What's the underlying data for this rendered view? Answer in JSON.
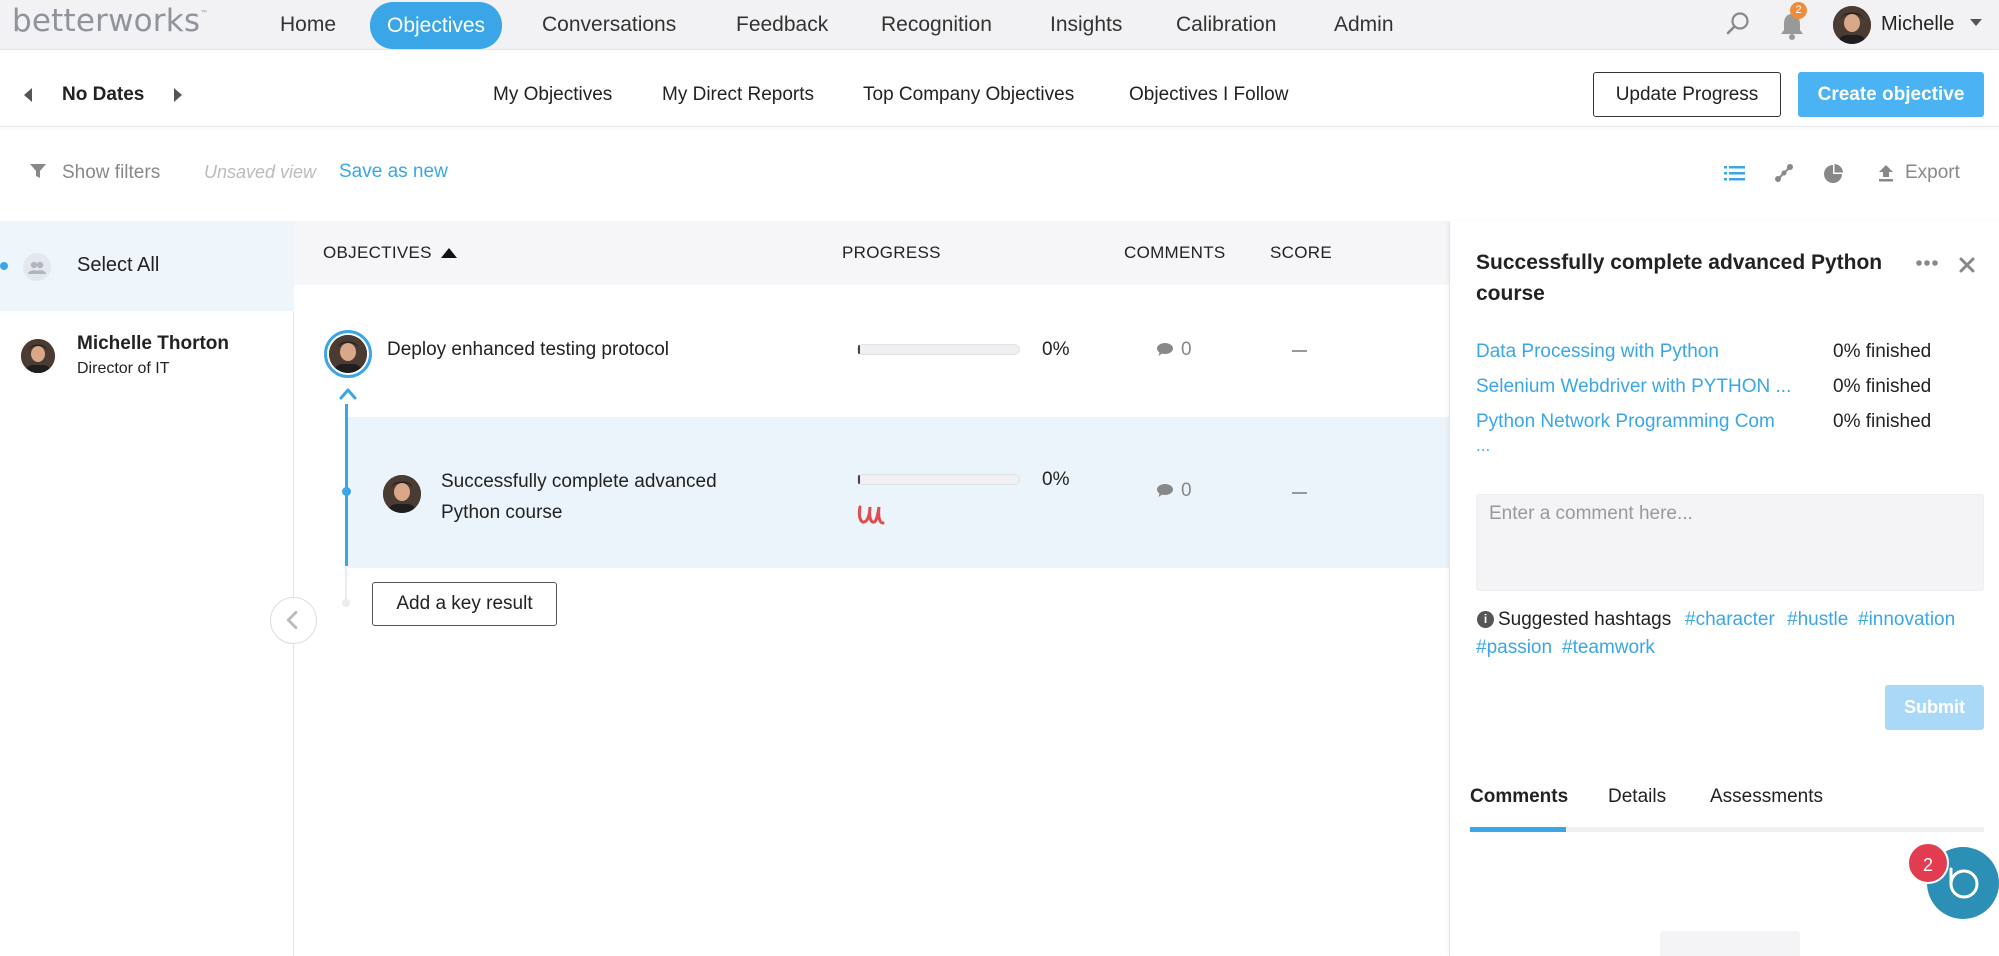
{
  "app": {
    "logo_text": "betterworks"
  },
  "topnav": {
    "items": [
      {
        "label": "Home"
      },
      {
        "label": "Objectives",
        "active": true
      },
      {
        "label": "Conversations"
      },
      {
        "label": "Feedback"
      },
      {
        "label": "Recognition"
      },
      {
        "label": "Insights"
      },
      {
        "label": "Calibration"
      },
      {
        "label": "Admin"
      }
    ],
    "notification_count": "2",
    "username": "Michelle",
    "icons": [
      "search-icon",
      "bell-icon",
      "chevron-down-icon"
    ]
  },
  "subnav": {
    "date_range": "No Dates",
    "tabs": [
      {
        "label": "My Objectives"
      },
      {
        "label": "My Direct Reports"
      },
      {
        "label": "Top Company Objectives"
      },
      {
        "label": "Objectives I Follow"
      }
    ],
    "update_progress_label": "Update Progress",
    "create_objective_label": "Create objective"
  },
  "filters": {
    "show_filters_label": "Show filters",
    "unsaved_view_label": "Unsaved view",
    "save_as_new_label": "Save as new",
    "export_label": "Export",
    "view_icons": [
      "list-view-icon",
      "tree-view-icon",
      "pie-chart-icon",
      "export-icon"
    ]
  },
  "left_panel": {
    "select_all_label": "Select All",
    "user": {
      "name": "Michelle Thorton",
      "title": "Director of IT"
    }
  },
  "table": {
    "headers": {
      "objectives": "OBJECTIVES",
      "progress": "PROGRESS",
      "comments": "COMMENTS",
      "score": "SCORE"
    },
    "objective": {
      "title": "Deploy enhanced testing protocol",
      "progress_pct": "0%",
      "progress_value": 0,
      "comment_count": "0",
      "score": "—"
    },
    "key_result": {
      "title": "Successfully complete advanced Python course",
      "progress_pct": "0%",
      "progress_value": 0,
      "comment_count": "0",
      "score": "—"
    },
    "add_key_result_label": "Add a key result"
  },
  "detail": {
    "title": "Successfully complete advanced Python course",
    "courses": [
      {
        "name": "Data Processing with Python",
        "status": "0% finished"
      },
      {
        "name": "Selenium Webdriver with PYTHON ...",
        "status": "0% finished"
      },
      {
        "name": "Python Network Programming Com",
        "name_cont": "...",
        "status": "0% finished"
      }
    ],
    "comment_placeholder": "Enter a comment here...",
    "hashtags_label": "Suggested hashtags",
    "hashtags": [
      "#character",
      "#hustle",
      "#innovation",
      "#passion",
      "#teamwork"
    ],
    "submit_label": "Submit",
    "tabs": [
      {
        "label": "Comments",
        "active": true
      },
      {
        "label": "Details"
      },
      {
        "label": "Assessments"
      }
    ]
  },
  "chat": {
    "badge_count": "2"
  },
  "colors": {
    "accent": "#3aa6e8",
    "primary_button": "#4bb2f3",
    "notification_badge": "#ef8c3a",
    "chat_badge": "#e23c50",
    "chat_bubble": "#2c8fb5"
  }
}
